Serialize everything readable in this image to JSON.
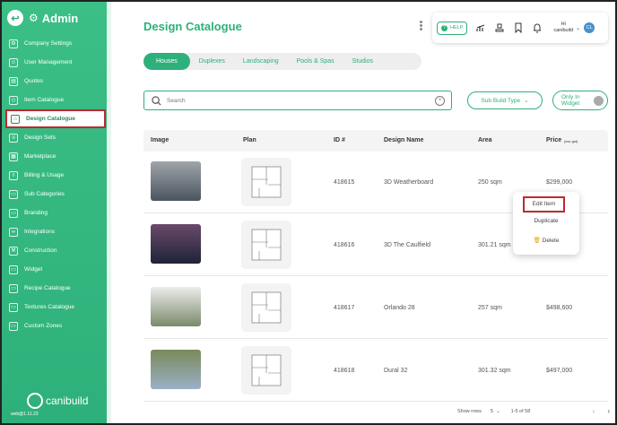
{
  "sidebar": {
    "title": "Admin",
    "items": [
      {
        "label": "Company Settings",
        "icon": "gear-icon"
      },
      {
        "label": "User Management",
        "icon": "users-icon"
      },
      {
        "label": "Quotes",
        "icon": "document-icon"
      },
      {
        "label": "Item Catalogue",
        "icon": "tag-icon"
      },
      {
        "label": "Design Catalogue",
        "icon": "house-icon"
      },
      {
        "label": "Design Sets",
        "icon": "layers-icon"
      },
      {
        "label": "Marketplace",
        "icon": "store-icon"
      },
      {
        "label": "Billing & Usage",
        "icon": "shield-icon"
      },
      {
        "label": "Sub Categories",
        "icon": "folder-icon"
      },
      {
        "label": "Branding",
        "icon": "folder-icon"
      },
      {
        "label": "Integrations",
        "icon": "plug-icon"
      },
      {
        "label": "Construction",
        "icon": "hammer-icon"
      },
      {
        "label": "Widget",
        "icon": "folder-icon"
      },
      {
        "label": "Recipe Catalogue",
        "icon": "folder-icon"
      },
      {
        "label": "Textures Catalogue",
        "icon": "folder-icon"
      },
      {
        "label": "Custom Zones",
        "icon": "folder-icon"
      }
    ],
    "logo_text": "canibuild",
    "version": "web@1.11.23"
  },
  "header": {
    "title": "Design Catalogue",
    "help_label": "HELP",
    "user_greeting": "Hi",
    "user_name": "canibuild",
    "avatar_initials": "CL"
  },
  "tabs": [
    "Houses",
    "Duplexes",
    "Landscaping",
    "Pools & Spas",
    "Studios"
  ],
  "filters": {
    "search_placeholder": "Search",
    "sub_build_type": "Sub Build Type",
    "only_in_widget": "Only In Widget"
  },
  "table": {
    "columns": [
      "Image",
      "Plan",
      "ID #",
      "Design Name",
      "Area",
      "Price",
      "(exc gst)"
    ],
    "rows": [
      {
        "id": "418615",
        "name": "3D Weatherboard",
        "area": "250 sqm",
        "price": "$299,000"
      },
      {
        "id": "418616",
        "name": "3D The Caulfield",
        "area": "301.21 sqm",
        "price": ""
      },
      {
        "id": "418617",
        "name": "Orlando 28",
        "area": "257 sqm",
        "price": "$498,600"
      },
      {
        "id": "418618",
        "name": "Dural 32",
        "area": "301.32 sqm",
        "price": "$497,000"
      }
    ]
  },
  "context_menu": {
    "edit": "Edit Item",
    "duplicate": "Duplicate",
    "delete": "Delete"
  },
  "pagination": {
    "rows_label": "Show rows",
    "rows_value": "5",
    "range": "1-5 of 58"
  }
}
